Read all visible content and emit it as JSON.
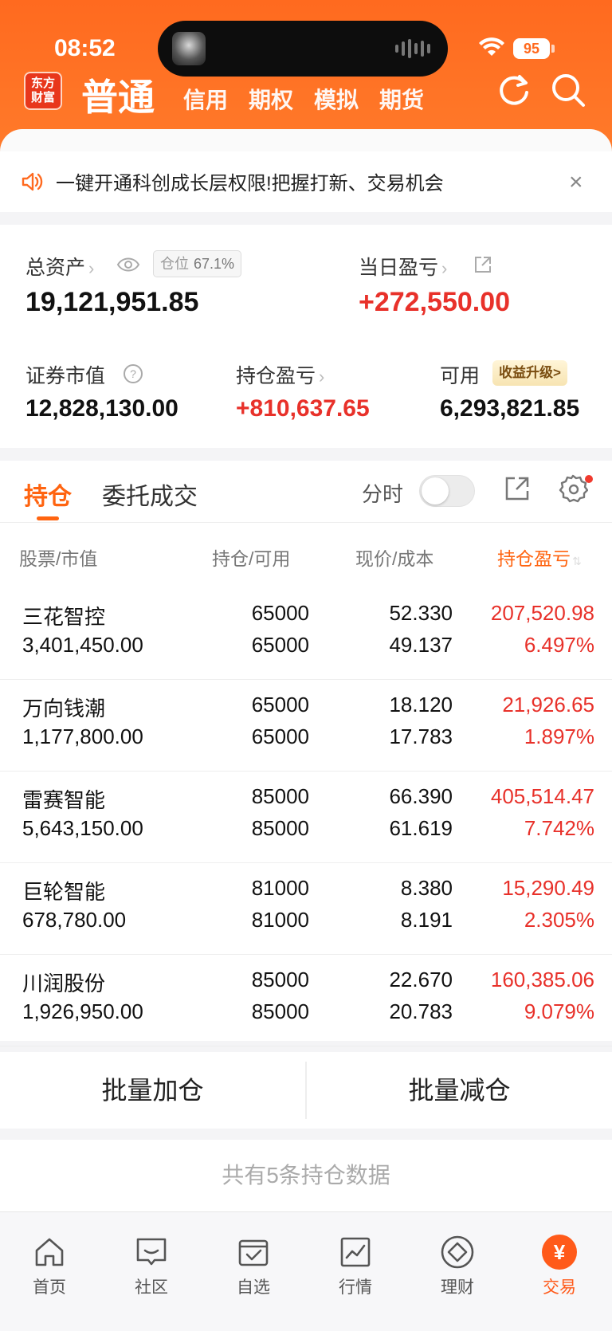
{
  "status": {
    "time": "08:52",
    "battery": "95"
  },
  "header": {
    "logo": [
      "东方",
      "财富"
    ],
    "main_tab": "普通",
    "tabs": [
      "信用",
      "期权",
      "模拟",
      "期货"
    ]
  },
  "banner": {
    "text": "一键开通科创成长层权限!把握打新、交易机会",
    "close": "×"
  },
  "assets": {
    "total_label": "总资产",
    "position_label": "仓位",
    "position_value": "67.1%",
    "total_value": "19,121,951.85",
    "daily_pl_label": "当日盈亏",
    "daily_pl_value": "+272,550.00",
    "market_value_label": "证券市值",
    "market_value": "12,828,130.00",
    "holding_pl_label": "持仓盈亏",
    "holding_pl_value": "+810,637.65",
    "available_label": "可用",
    "yield_upgrade": "收益升级>",
    "available_value": "6,293,821.85"
  },
  "holdings_tabs": {
    "active": "持仓",
    "other": "委托成交",
    "fenshi": "分时"
  },
  "columns": {
    "stock": "股票/市值",
    "qty": "持仓/可用",
    "price": "现价/成本",
    "pl": "持仓盈亏"
  },
  "rows": [
    {
      "name": "三花智控",
      "mv": "3,401,450.00",
      "qty": "65000",
      "avail": "65000",
      "price": "52.330",
      "cost": "49.137",
      "pl": "207,520.98",
      "pct": "6.497%"
    },
    {
      "name": "万向钱潮",
      "mv": "1,177,800.00",
      "qty": "65000",
      "avail": "65000",
      "price": "18.120",
      "cost": "17.783",
      "pl": "21,926.65",
      "pct": "1.897%"
    },
    {
      "name": "雷赛智能",
      "mv": "5,643,150.00",
      "qty": "85000",
      "avail": "85000",
      "price": "66.390",
      "cost": "61.619",
      "pl": "405,514.47",
      "pct": "7.742%"
    },
    {
      "name": "巨轮智能",
      "mv": "678,780.00",
      "qty": "81000",
      "avail": "81000",
      "price": "8.380",
      "cost": "8.191",
      "pl": "15,290.49",
      "pct": "2.305%"
    },
    {
      "name": "川润股份",
      "mv": "1,926,950.00",
      "qty": "85000",
      "avail": "85000",
      "price": "22.670",
      "cost": "20.783",
      "pl": "160,385.06",
      "pct": "9.079%"
    }
  ],
  "actions": {
    "add": "批量加仓",
    "reduce": "批量减仓"
  },
  "footer_note": "共有5条持仓数据",
  "tabbar": [
    {
      "label": "首页",
      "icon": "home-icon"
    },
    {
      "label": "社区",
      "icon": "community-icon"
    },
    {
      "label": "自选",
      "icon": "watchlist-icon"
    },
    {
      "label": "行情",
      "icon": "market-icon"
    },
    {
      "label": "理财",
      "icon": "wealth-icon"
    },
    {
      "label": "交易",
      "icon": "trade-icon",
      "yen": "¥"
    }
  ],
  "colors": {
    "brand": "#ff6a1f",
    "up": "#e8312a",
    "accent": "#ff6410"
  }
}
